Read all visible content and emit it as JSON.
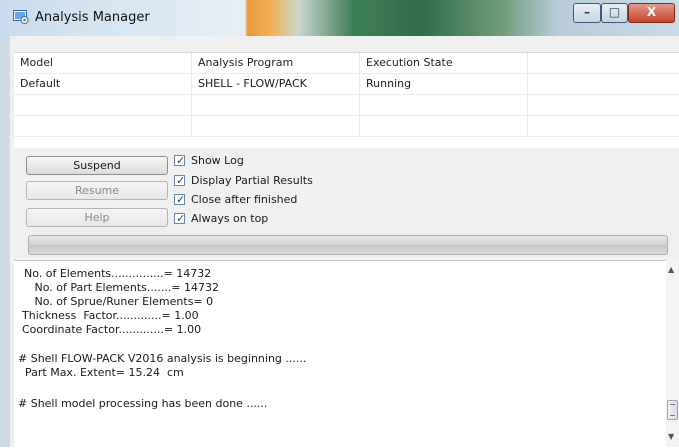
{
  "window": {
    "title": "Analysis Manager",
    "minimize_glyph": "–",
    "maximize_glyph": "□",
    "close_glyph": "X"
  },
  "table": {
    "headers": [
      "Model",
      "Analysis Program",
      "Execution State",
      ""
    ],
    "rows": [
      [
        "Default",
        "SHELL - FLOW/PACK",
        "Running",
        ""
      ],
      [
        "",
        "",
        "",
        ""
      ],
      [
        "",
        "",
        "",
        ""
      ]
    ]
  },
  "buttons": {
    "suspend": "Suspend",
    "resume": "Resume",
    "help": "Help"
  },
  "options": [
    {
      "label": "Show Log",
      "checked": true
    },
    {
      "label": "Display Partial Results",
      "checked": true
    },
    {
      "label": "Close after finished",
      "checked": true
    },
    {
      "label": "Always on top",
      "checked": true
    }
  ],
  "progress": {
    "fraction": 0.0
  },
  "log": {
    "lines": [
      "No. of Elements...............= 14732",
      "   No. of Part Elements.......= 14732",
      "   No. of Sprue/Runer Elements= 0",
      "Thickness  Factor.............= 1.00",
      "Coordinate Factor.............= 1.00",
      "",
      "# Shell FLOW-PACK V2016 analysis is beginning ......",
      "  Part Max. Extent= 15.24  cm",
      "",
      "# Shell model processing has been done ......"
    ]
  },
  "icons": {
    "app": "analysis-manager-icon",
    "check": "✓",
    "scroll_up": "▲",
    "scroll_down": "▼"
  },
  "colors": {
    "close_button": "#c7432c",
    "checkbox_border": "#6e87a8"
  }
}
